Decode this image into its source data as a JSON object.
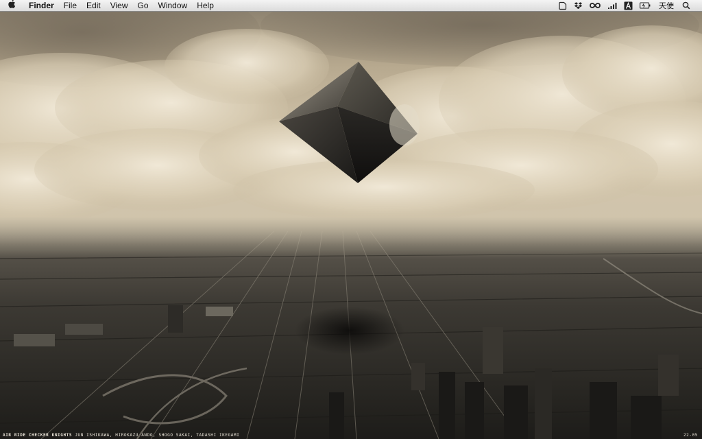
{
  "menubar": {
    "apple_icon": "apple-icon",
    "app_name": "Finder",
    "menus": [
      "File",
      "Edit",
      "View",
      "Go",
      "Window",
      "Help"
    ],
    "status_icons": [
      "chat-bubble-icon",
      "dropbox-icon",
      "infinity-icon",
      "signal-bars-icon",
      "font-a-icon",
      "battery-icon"
    ],
    "user_name": "天使",
    "search_icon": "spotlight-search-icon"
  },
  "wallpaper": {
    "credit_title": "AIR RIDE CHECKER KNIGHTS",
    "credit_names": "JUN ISHIKAWA, HIROKAZU ANDO, SHOGO SAKAI, TADASHI IKEGAMI",
    "credit_code": "22-05"
  }
}
